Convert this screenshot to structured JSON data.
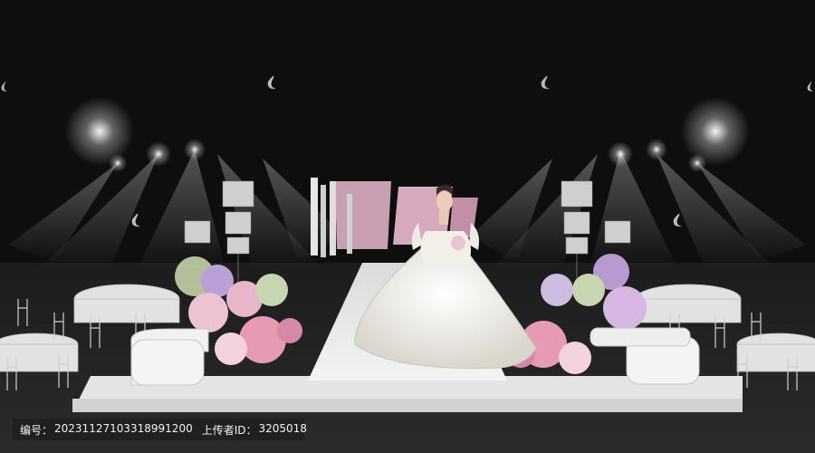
{
  "image": {
    "subject": "wedding-hall-render",
    "palette": {
      "background": "#0e0e0e",
      "stage": "#e9e9ec",
      "accent_pink": "#d9a5bb",
      "accent_purple": "#b79ad0",
      "gown": "#f3f1ea"
    }
  },
  "watermark": {
    "id_label": "编号：",
    "id_value": "20231127103318991200",
    "uploader_label": "上传者ID：",
    "uploader_value": "3205018"
  }
}
